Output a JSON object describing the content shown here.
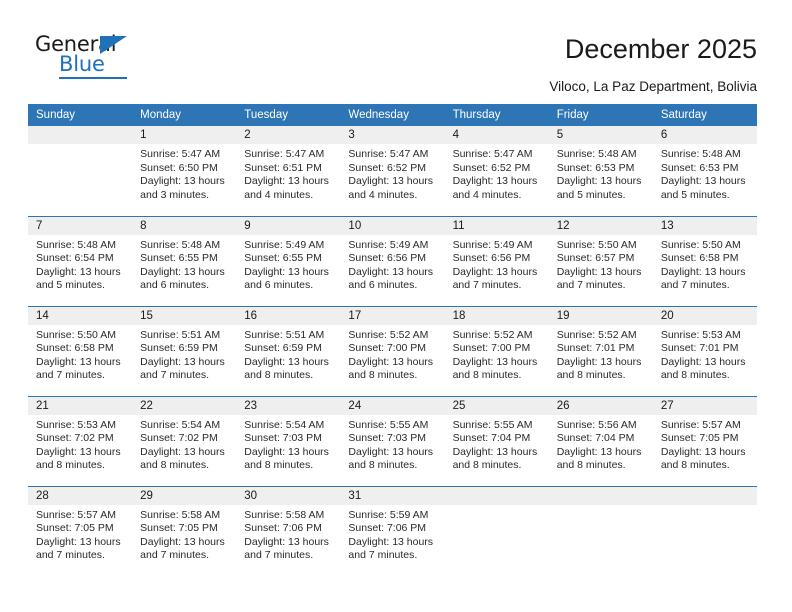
{
  "logo": {
    "word_top": "General",
    "word_bottom": "Blue",
    "triangle_icon": "blue-triangle-icon"
  },
  "header": {
    "title": "December 2025",
    "subtitle": "Viloco, La Paz Department, Bolivia"
  },
  "colors": {
    "header_blue": "#2E75B6",
    "logo_blue": "#2072B8",
    "daynum_band": "#EFEFEF",
    "text": "#1A1A1A"
  },
  "weekdays": [
    "Sunday",
    "Monday",
    "Tuesday",
    "Wednesday",
    "Thursday",
    "Friday",
    "Saturday"
  ],
  "weeks": [
    [
      {
        "day": "",
        "empty": true
      },
      {
        "day": "1",
        "sunrise": "Sunrise: 5:47 AM",
        "sunset": "Sunset: 6:50 PM",
        "daylight1": "Daylight: 13 hours",
        "daylight2": "and 3 minutes."
      },
      {
        "day": "2",
        "sunrise": "Sunrise: 5:47 AM",
        "sunset": "Sunset: 6:51 PM",
        "daylight1": "Daylight: 13 hours",
        "daylight2": "and 4 minutes."
      },
      {
        "day": "3",
        "sunrise": "Sunrise: 5:47 AM",
        "sunset": "Sunset: 6:52 PM",
        "daylight1": "Daylight: 13 hours",
        "daylight2": "and 4 minutes."
      },
      {
        "day": "4",
        "sunrise": "Sunrise: 5:47 AM",
        "sunset": "Sunset: 6:52 PM",
        "daylight1": "Daylight: 13 hours",
        "daylight2": "and 4 minutes."
      },
      {
        "day": "5",
        "sunrise": "Sunrise: 5:48 AM",
        "sunset": "Sunset: 6:53 PM",
        "daylight1": "Daylight: 13 hours",
        "daylight2": "and 5 minutes."
      },
      {
        "day": "6",
        "sunrise": "Sunrise: 5:48 AM",
        "sunset": "Sunset: 6:53 PM",
        "daylight1": "Daylight: 13 hours",
        "daylight2": "and 5 minutes."
      }
    ],
    [
      {
        "day": "7",
        "sunrise": "Sunrise: 5:48 AM",
        "sunset": "Sunset: 6:54 PM",
        "daylight1": "Daylight: 13 hours",
        "daylight2": "and 5 minutes."
      },
      {
        "day": "8",
        "sunrise": "Sunrise: 5:48 AM",
        "sunset": "Sunset: 6:55 PM",
        "daylight1": "Daylight: 13 hours",
        "daylight2": "and 6 minutes."
      },
      {
        "day": "9",
        "sunrise": "Sunrise: 5:49 AM",
        "sunset": "Sunset: 6:55 PM",
        "daylight1": "Daylight: 13 hours",
        "daylight2": "and 6 minutes."
      },
      {
        "day": "10",
        "sunrise": "Sunrise: 5:49 AM",
        "sunset": "Sunset: 6:56 PM",
        "daylight1": "Daylight: 13 hours",
        "daylight2": "and 6 minutes."
      },
      {
        "day": "11",
        "sunrise": "Sunrise: 5:49 AM",
        "sunset": "Sunset: 6:56 PM",
        "daylight1": "Daylight: 13 hours",
        "daylight2": "and 7 minutes."
      },
      {
        "day": "12",
        "sunrise": "Sunrise: 5:50 AM",
        "sunset": "Sunset: 6:57 PM",
        "daylight1": "Daylight: 13 hours",
        "daylight2": "and 7 minutes."
      },
      {
        "day": "13",
        "sunrise": "Sunrise: 5:50 AM",
        "sunset": "Sunset: 6:58 PM",
        "daylight1": "Daylight: 13 hours",
        "daylight2": "and 7 minutes."
      }
    ],
    [
      {
        "day": "14",
        "sunrise": "Sunrise: 5:50 AM",
        "sunset": "Sunset: 6:58 PM",
        "daylight1": "Daylight: 13 hours",
        "daylight2": "and 7 minutes."
      },
      {
        "day": "15",
        "sunrise": "Sunrise: 5:51 AM",
        "sunset": "Sunset: 6:59 PM",
        "daylight1": "Daylight: 13 hours",
        "daylight2": "and 7 minutes."
      },
      {
        "day": "16",
        "sunrise": "Sunrise: 5:51 AM",
        "sunset": "Sunset: 6:59 PM",
        "daylight1": "Daylight: 13 hours",
        "daylight2": "and 8 minutes."
      },
      {
        "day": "17",
        "sunrise": "Sunrise: 5:52 AM",
        "sunset": "Sunset: 7:00 PM",
        "daylight1": "Daylight: 13 hours",
        "daylight2": "and 8 minutes."
      },
      {
        "day": "18",
        "sunrise": "Sunrise: 5:52 AM",
        "sunset": "Sunset: 7:00 PM",
        "daylight1": "Daylight: 13 hours",
        "daylight2": "and 8 minutes."
      },
      {
        "day": "19",
        "sunrise": "Sunrise: 5:52 AM",
        "sunset": "Sunset: 7:01 PM",
        "daylight1": "Daylight: 13 hours",
        "daylight2": "and 8 minutes."
      },
      {
        "day": "20",
        "sunrise": "Sunrise: 5:53 AM",
        "sunset": "Sunset: 7:01 PM",
        "daylight1": "Daylight: 13 hours",
        "daylight2": "and 8 minutes."
      }
    ],
    [
      {
        "day": "21",
        "sunrise": "Sunrise: 5:53 AM",
        "sunset": "Sunset: 7:02 PM",
        "daylight1": "Daylight: 13 hours",
        "daylight2": "and 8 minutes."
      },
      {
        "day": "22",
        "sunrise": "Sunrise: 5:54 AM",
        "sunset": "Sunset: 7:02 PM",
        "daylight1": "Daylight: 13 hours",
        "daylight2": "and 8 minutes."
      },
      {
        "day": "23",
        "sunrise": "Sunrise: 5:54 AM",
        "sunset": "Sunset: 7:03 PM",
        "daylight1": "Daylight: 13 hours",
        "daylight2": "and 8 minutes."
      },
      {
        "day": "24",
        "sunrise": "Sunrise: 5:55 AM",
        "sunset": "Sunset: 7:03 PM",
        "daylight1": "Daylight: 13 hours",
        "daylight2": "and 8 minutes."
      },
      {
        "day": "25",
        "sunrise": "Sunrise: 5:55 AM",
        "sunset": "Sunset: 7:04 PM",
        "daylight1": "Daylight: 13 hours",
        "daylight2": "and 8 minutes."
      },
      {
        "day": "26",
        "sunrise": "Sunrise: 5:56 AM",
        "sunset": "Sunset: 7:04 PM",
        "daylight1": "Daylight: 13 hours",
        "daylight2": "and 8 minutes."
      },
      {
        "day": "27",
        "sunrise": "Sunrise: 5:57 AM",
        "sunset": "Sunset: 7:05 PM",
        "daylight1": "Daylight: 13 hours",
        "daylight2": "and 8 minutes."
      }
    ],
    [
      {
        "day": "28",
        "sunrise": "Sunrise: 5:57 AM",
        "sunset": "Sunset: 7:05 PM",
        "daylight1": "Daylight: 13 hours",
        "daylight2": "and 7 minutes."
      },
      {
        "day": "29",
        "sunrise": "Sunrise: 5:58 AM",
        "sunset": "Sunset: 7:05 PM",
        "daylight1": "Daylight: 13 hours",
        "daylight2": "and 7 minutes."
      },
      {
        "day": "30",
        "sunrise": "Sunrise: 5:58 AM",
        "sunset": "Sunset: 7:06 PM",
        "daylight1": "Daylight: 13 hours",
        "daylight2": "and 7 minutes."
      },
      {
        "day": "31",
        "sunrise": "Sunrise: 5:59 AM",
        "sunset": "Sunset: 7:06 PM",
        "daylight1": "Daylight: 13 hours",
        "daylight2": "and 7 minutes."
      },
      {
        "day": "",
        "empty": true
      },
      {
        "day": "",
        "empty": true
      },
      {
        "day": "",
        "empty": true
      }
    ]
  ]
}
